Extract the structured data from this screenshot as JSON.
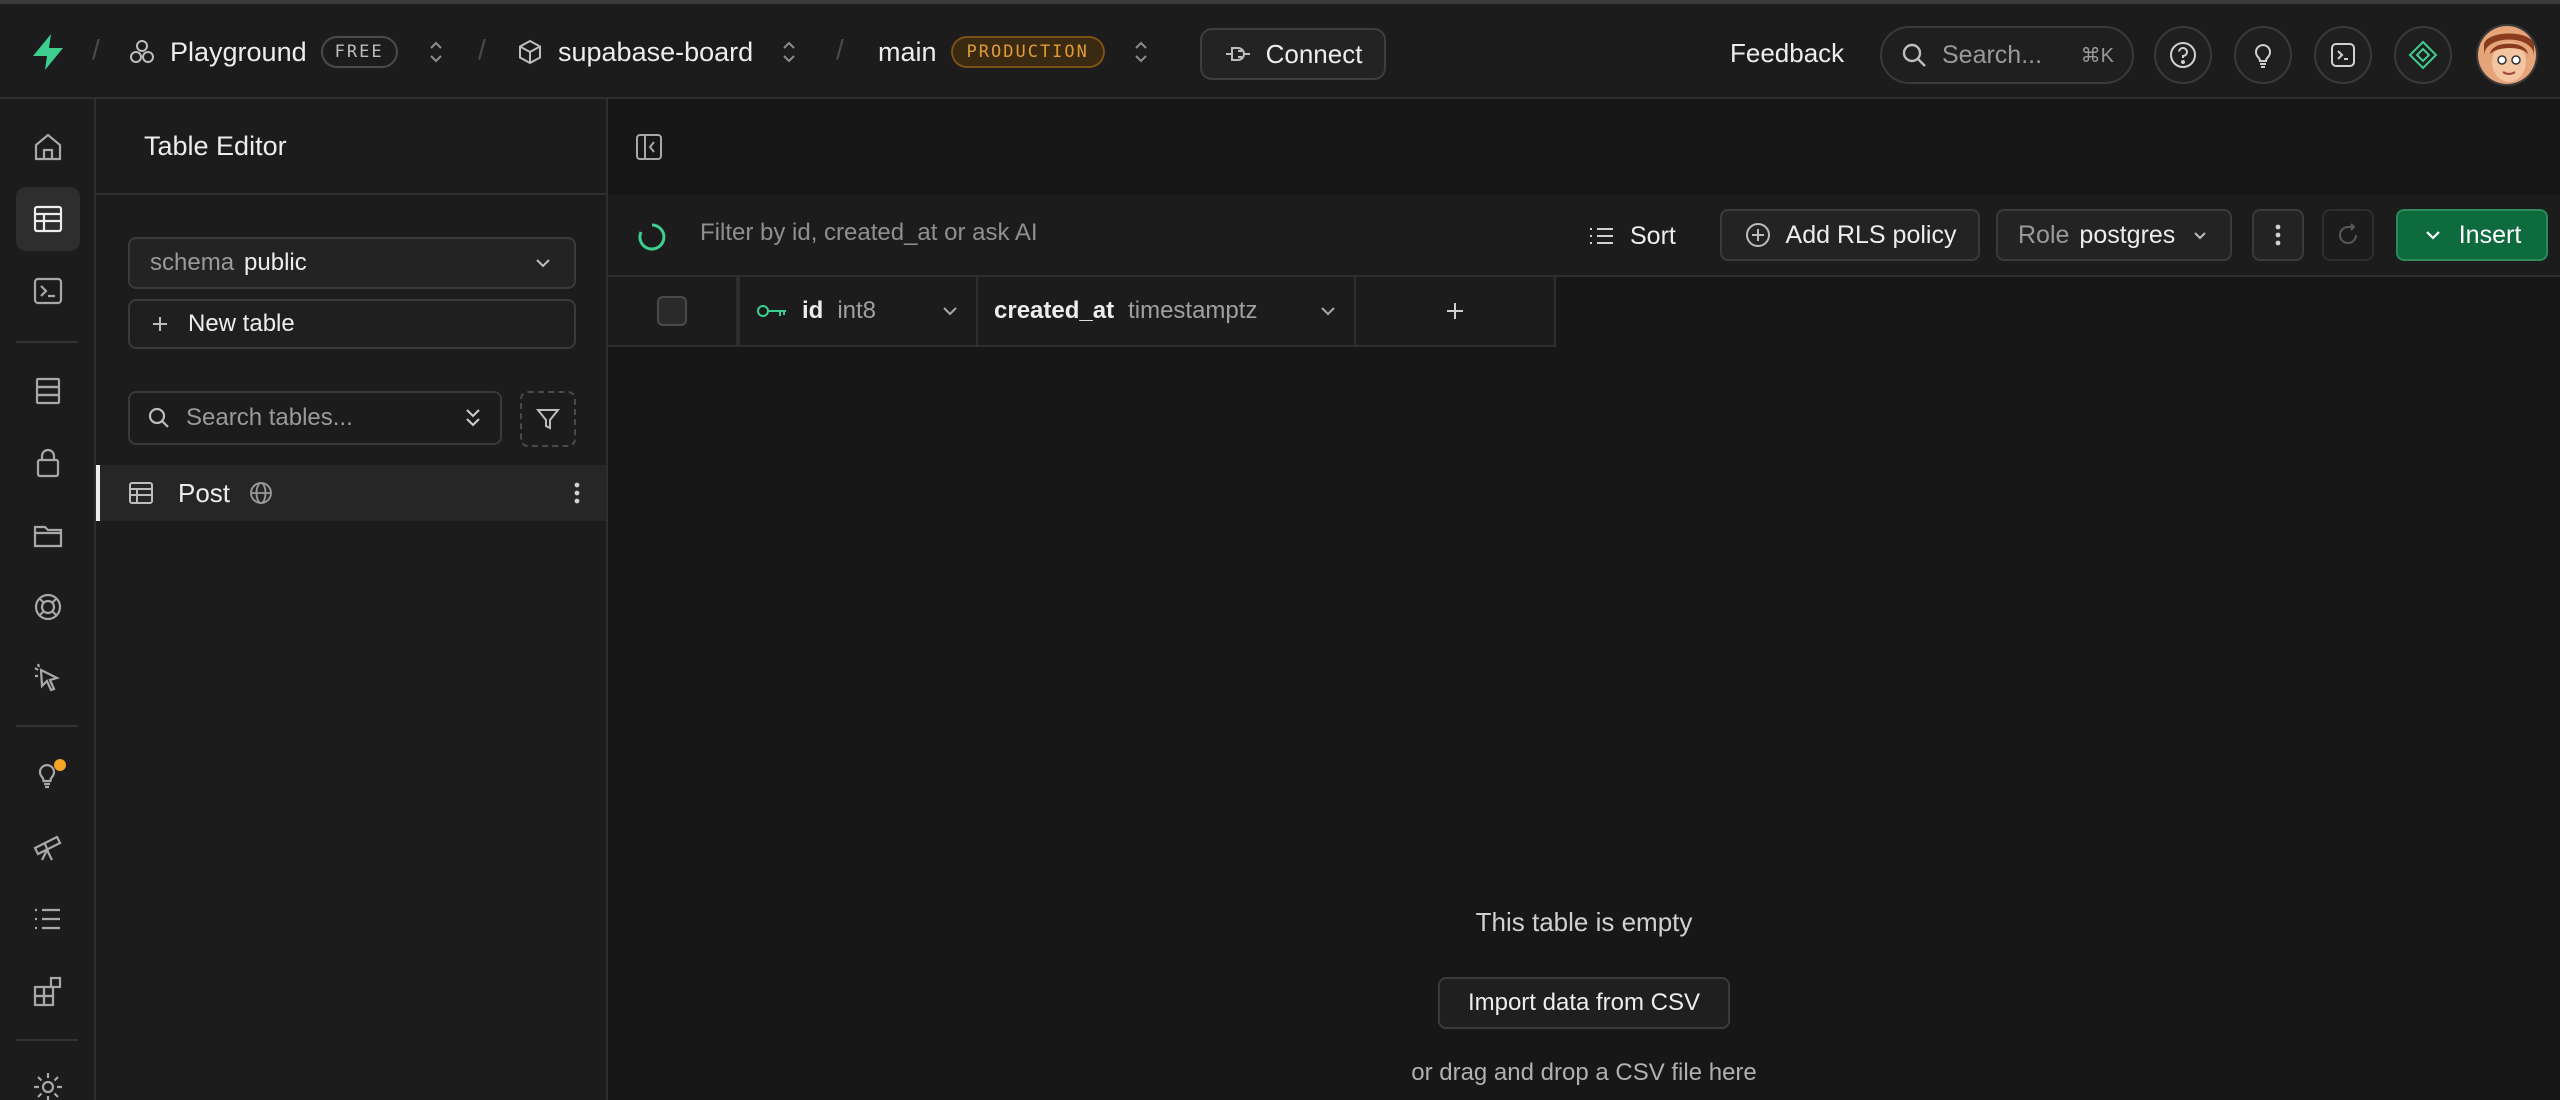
{
  "header": {
    "org": {
      "name": "Playground",
      "plan": "FREE"
    },
    "project": {
      "name": "supabase-board"
    },
    "branch": {
      "name": "main",
      "env": "PRODUCTION"
    },
    "connect_label": "Connect",
    "feedback_label": "Feedback",
    "search": {
      "placeholder": "Search...",
      "shortcut": "⌘K"
    }
  },
  "iconbar": {
    "items": [
      "home-icon",
      "table-editor-icon",
      "sql-editor-icon",
      "database-icon",
      "auth-icon",
      "storage-icon",
      "realtime-icon",
      "edge-functions-icon",
      "advisors-icon",
      "observability-icon",
      "logs-icon",
      "integrations-icon",
      "settings-icon"
    ],
    "notification_color": "#f5a524"
  },
  "sidebar": {
    "title": "Table Editor",
    "schema_label": "schema",
    "schema_value": "public",
    "new_table_label": "New table",
    "search_placeholder": "Search tables...",
    "tables": [
      {
        "name": "Post"
      }
    ]
  },
  "toolbar": {
    "filter_placeholder": "Filter by id, created_at or ask AI",
    "sort_label": "Sort",
    "rls_label": "Add RLS policy",
    "role_label": "Role",
    "role_value": "postgres",
    "insert_label": "Insert"
  },
  "grid": {
    "columns": [
      {
        "name": "id",
        "type": "int8",
        "primary_key": true
      },
      {
        "name": "created_at",
        "type": "timestamptz",
        "primary_key": false
      }
    ]
  },
  "empty_state": {
    "message": "This table is empty",
    "import_label": "Import data from CSV",
    "drop_hint": "or drag and drop a CSV file here"
  },
  "colors": {
    "brand": "#3ecf8e",
    "insert_bg": "#0e6b3e",
    "production": "#e29a38"
  }
}
